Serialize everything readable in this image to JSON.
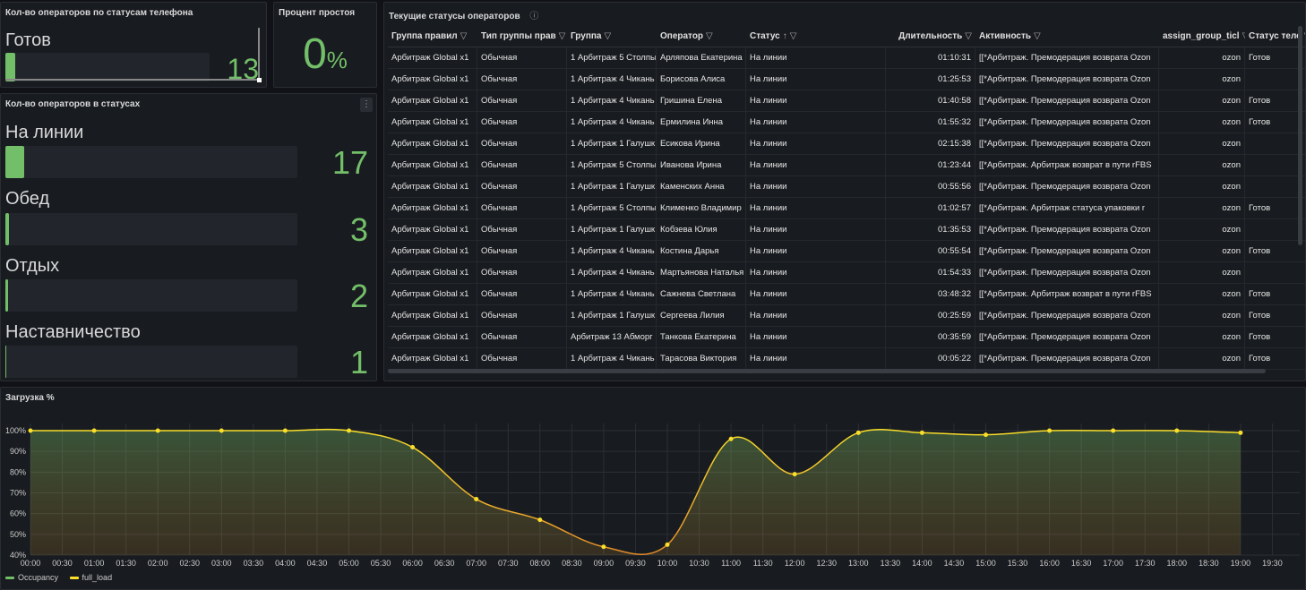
{
  "panels": {
    "phone_status": {
      "title": "Кол-во операторов по статусам телефона",
      "items": [
        {
          "label": "Готов",
          "value": "13",
          "fraction": 0.05
        }
      ]
    },
    "idle": {
      "title": "Процент простоя",
      "value": "0",
      "unit": "%"
    },
    "statuses": {
      "title": "Кол-во операторов в статусах",
      "menu": "⋮",
      "items": [
        {
          "label": "На линии",
          "value": "17",
          "fraction": 0.065
        },
        {
          "label": "Обед",
          "value": "3",
          "fraction": 0.012
        },
        {
          "label": "Отдых",
          "value": "2",
          "fraction": 0.008
        },
        {
          "label": "Наставничество",
          "value": "1",
          "fraction": 0.004
        }
      ]
    },
    "table": {
      "title": "Текущие статусы операторов",
      "info_icon": "ⓘ",
      "filter_icon": "▽",
      "sort_icon": "↑",
      "columns": [
        "Группа правил",
        "Тип группы прав",
        "Группа",
        "Оператор",
        "Статус",
        "Длительность",
        "Активность",
        "assign_group_ticl",
        "Статус теле"
      ],
      "rows": [
        [
          "Арбитраж Global x1",
          "Обычная",
          "1 Арбитраж 5 Столпы",
          "Арляпова Екатерина",
          "На линии",
          "01:10:31",
          "[[*Арбитраж. Премодерация возврата Ozon",
          "ozon",
          "Готов"
        ],
        [
          "Арбитраж Global x1",
          "Обычная",
          "1 Арбитраж 4 Чикань",
          "Борисова Алиса",
          "На линии",
          "01:25:53",
          "[[*Арбитраж. Премодерация возврата Ozon",
          "ozon",
          ""
        ],
        [
          "Арбитраж Global x1",
          "Обычная",
          "1 Арбитраж 4 Чикань",
          "Гришина Елена",
          "На линии",
          "01:40:58",
          "[[*Арбитраж. Премодерация возврата Ozon",
          "ozon",
          "Готов"
        ],
        [
          "Арбитраж Global x1",
          "Обычная",
          "1 Арбитраж 4 Чикань",
          "Ермилина Инна",
          "На линии",
          "01:55:32",
          "[[*Арбитраж. Премодерация возврата Ozon",
          "ozon",
          "Готов"
        ],
        [
          "Арбитраж Global x1",
          "Обычная",
          "1 Арбитраж 1 Галушк",
          "Есикова Ирина",
          "На линии",
          "02:15:38",
          "[[*Арбитраж. Премодерация возврата Ozon",
          "ozon",
          ""
        ],
        [
          "Арбитраж Global x1",
          "Обычная",
          "1 Арбитраж 5 Столпы",
          "Иванова Ирина",
          "На линии",
          "01:23:44",
          "[[*Арбитраж. Арбитраж возврат в пути rFBS",
          "ozon",
          ""
        ],
        [
          "Арбитраж Global x1",
          "Обычная",
          "1 Арбитраж 1 Галушк",
          "Каменских Анна",
          "На линии",
          "00:55:56",
          "[[*Арбитраж. Премодерация возврата Ozon",
          "ozon",
          ""
        ],
        [
          "Арбитраж Global x1",
          "Обычная",
          "1 Арбитраж 5 Столпы",
          "Клименко Владимир",
          "На линии",
          "01:02:57",
          "[[*Арбитраж. Арбитраж статуса упаковки r",
          "ozon",
          "Готов"
        ],
        [
          "Арбитраж Global x1",
          "Обычная",
          "1 Арбитраж 1 Галушк",
          "Кобзева Юлия",
          "На линии",
          "01:35:53",
          "[[*Арбитраж. Премодерация возврата Ozon",
          "ozon",
          ""
        ],
        [
          "Арбитраж Global x1",
          "Обычная",
          "1 Арбитраж 4 Чикань",
          "Костина Дарья",
          "На линии",
          "00:55:54",
          "[[*Арбитраж. Премодерация возврата Ozon",
          "ozon",
          "Готов"
        ],
        [
          "Арбитраж Global x1",
          "Обычная",
          "1 Арбитраж 4 Чикань",
          "Мартьянова Наталья",
          "На линии",
          "01:54:33",
          "[[*Арбитраж. Премодерация возврата Ozon",
          "ozon",
          ""
        ],
        [
          "Арбитраж Global x1",
          "Обычная",
          "1 Арбитраж 4 Чикань",
          "Сажнева Светлана",
          "На линии",
          "03:48:32",
          "[[*Арбитраж. Арбитраж возврат в пути rFBS",
          "ozon",
          "Готов"
        ],
        [
          "Арбитраж Global x1",
          "Обычная",
          "1 Арбитраж 1 Галушк",
          "Сергеева Лилия",
          "На линии",
          "00:25:59",
          "[[*Арбитраж. Премодерация возврата Ozon",
          "ozon",
          "Готов"
        ],
        [
          "Арбитраж Global x1",
          "Обычная",
          "Арбитраж 13 Абморг",
          "Танкова Екатерина",
          "На линии",
          "00:35:59",
          "[[*Арбитраж. Премодерация возврата Ozon",
          "ozon",
          "Готов"
        ],
        [
          "Арбитраж Global x1",
          "Обычная",
          "1 Арбитраж 4 Чикань",
          "Тарасова Виктория",
          "На линии",
          "00:05:22",
          "[[*Арбитраж. Премодерация возврата Ozon",
          "ozon",
          "Готов"
        ]
      ]
    },
    "load": {
      "title": "Загрузка %"
    }
  },
  "chart_data": {
    "type": "line",
    "title": "Загрузка %",
    "x": [
      "00:00",
      "01:00",
      "02:00",
      "03:00",
      "04:00",
      "05:00",
      "06:00",
      "07:00",
      "08:00",
      "09:00",
      "10:00",
      "11:00",
      "12:00",
      "13:00",
      "14:00",
      "15:00",
      "16:00",
      "17:00",
      "18:00",
      "19:00"
    ],
    "x_ticks": [
      "00:00",
      "00:30",
      "01:00",
      "01:30",
      "02:00",
      "02:30",
      "03:00",
      "03:30",
      "04:00",
      "04:30",
      "05:00",
      "05:30",
      "06:00",
      "06:30",
      "07:00",
      "07:30",
      "08:00",
      "08:30",
      "09:00",
      "09:30",
      "10:00",
      "10:30",
      "11:00",
      "11:30",
      "12:00",
      "12:30",
      "13:00",
      "13:30",
      "14:00",
      "14:30",
      "15:00",
      "15:30",
      "16:00",
      "16:30",
      "17:00",
      "17:30",
      "18:00",
      "18:30",
      "19:00",
      "19:30"
    ],
    "y_ticks": [
      "40%",
      "50%",
      "60%",
      "70%",
      "80%",
      "90%",
      "100%"
    ],
    "ylim": [
      40,
      100
    ],
    "series": [
      {
        "name": "Occupancy",
        "color": "#73bf69",
        "values": [
          100,
          100,
          100,
          100,
          100,
          100,
          92,
          67,
          57,
          44,
          45,
          96,
          79,
          99,
          99,
          98,
          100,
          100,
          100,
          99
        ]
      },
      {
        "name": "full_load",
        "color": "#fade2a",
        "values": [
          100,
          100,
          100,
          100,
          100,
          100,
          92,
          67,
          57,
          44,
          45,
          96,
          79,
          99,
          99,
          98,
          100,
          100,
          100,
          99
        ]
      }
    ],
    "grid": true,
    "legend": "bottom-left"
  }
}
